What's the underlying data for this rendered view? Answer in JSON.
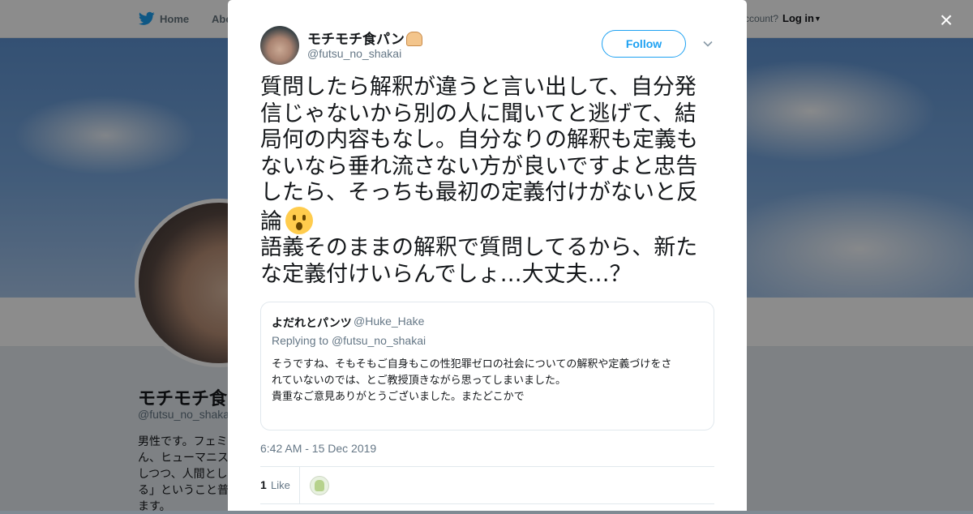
{
  "nav": {
    "home_label": "Home",
    "about_label": "Abo",
    "account_prompt": "ccount?",
    "login_label": "Log in"
  },
  "profile_bg": {
    "name": "モチモチ食パ",
    "handle": "@futsu_no_shakai",
    "bio_lines": [
      "男性です。フェミ",
      "ん、ヒューマニス",
      "しつつ、人間とし",
      "る」ということ普",
      "ます。"
    ]
  },
  "close_label": "×",
  "tweet": {
    "author_name": "モチモチ食パン",
    "author_emoji_icon": "bread-icon",
    "author_handle": "@futsu_no_shakai",
    "follow_label": "Follow",
    "menu_icon": "chevron-down-icon",
    "text_lines": [
      "質問したら解釈が違うと言い出して、自分発",
      "信じゃないから別の人に聞いてと逃げて、結",
      "局何の内容もなし。自分なりの解釈も定義も",
      "ないなら垂れ流さない方が良いですよと忠告",
      "したら、そっちも最初の定義付けがないと反",
      "論",
      "語義そのままの解釈で質問してるから、新た",
      "な定義付けいらんでしょ…大丈夫…？"
    ],
    "emoji_icon": "surprised-face-emoji",
    "timestamp": "6:42 AM - 15 Dec 2019",
    "like_count": "1",
    "like_label": "Like"
  },
  "quoted": {
    "name": "よだれとパンツ",
    "handle": "@Huke_Hake",
    "replying_prefix": "Replying to",
    "replying_handle": "@futsu_no_shakai",
    "body_lines": [
      "そうですね、そもそもご自身もこの性犯罪ゼロの社会についての解釈や定義づけをさ",
      "れていないのでは、とご教授頂きながら思ってしまいました。",
      "貴重なご意見ありがとうございました。またどこかで"
    ]
  },
  "colors": {
    "brand_blue": "#1da1f2",
    "text_primary": "#14171a",
    "text_secondary": "#657786"
  }
}
